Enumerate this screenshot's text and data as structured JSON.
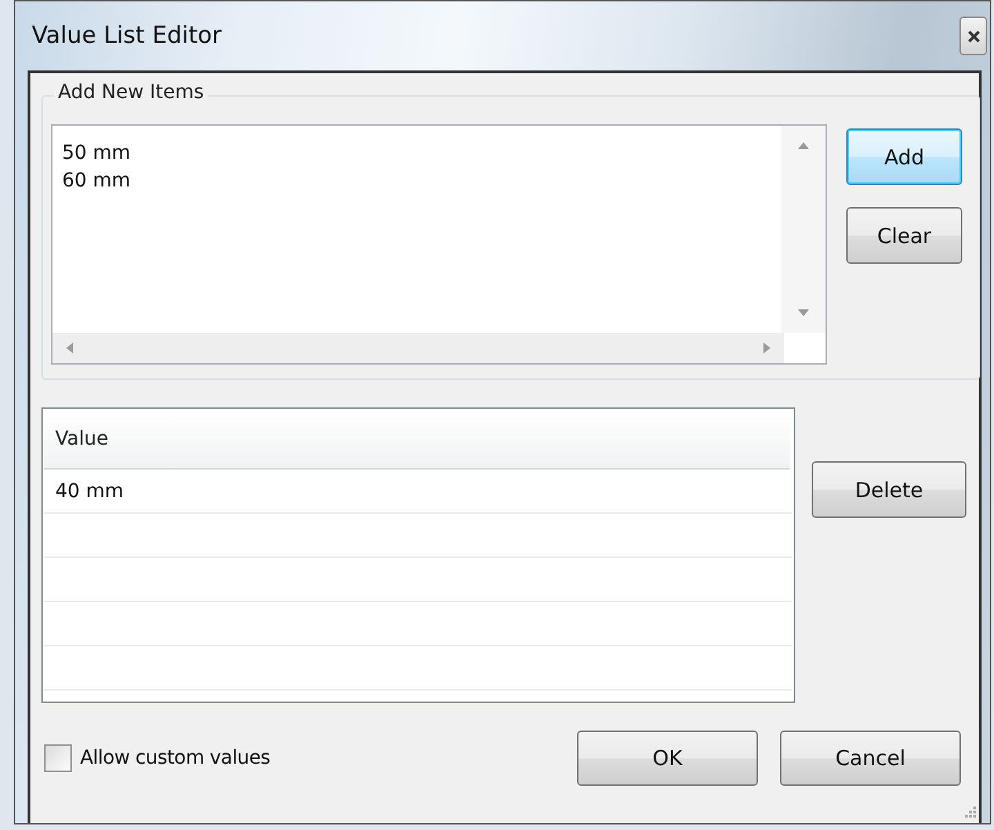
{
  "window": {
    "title": "Value List Editor"
  },
  "add_group": {
    "label": "Add New Items",
    "lines": [
      "50 mm",
      "60 mm"
    ],
    "buttons": [
      {
        "label": "Add",
        "default": true
      },
      {
        "label": "Clear",
        "default": false
      }
    ]
  },
  "list": {
    "columns": [
      "Value"
    ],
    "rows": [
      "40 mm"
    ],
    "button": "Delete"
  },
  "allow_custom": {
    "label": "Allow custom values",
    "checked": false
  },
  "buttons": [
    "OK",
    "Cancel"
  ]
}
